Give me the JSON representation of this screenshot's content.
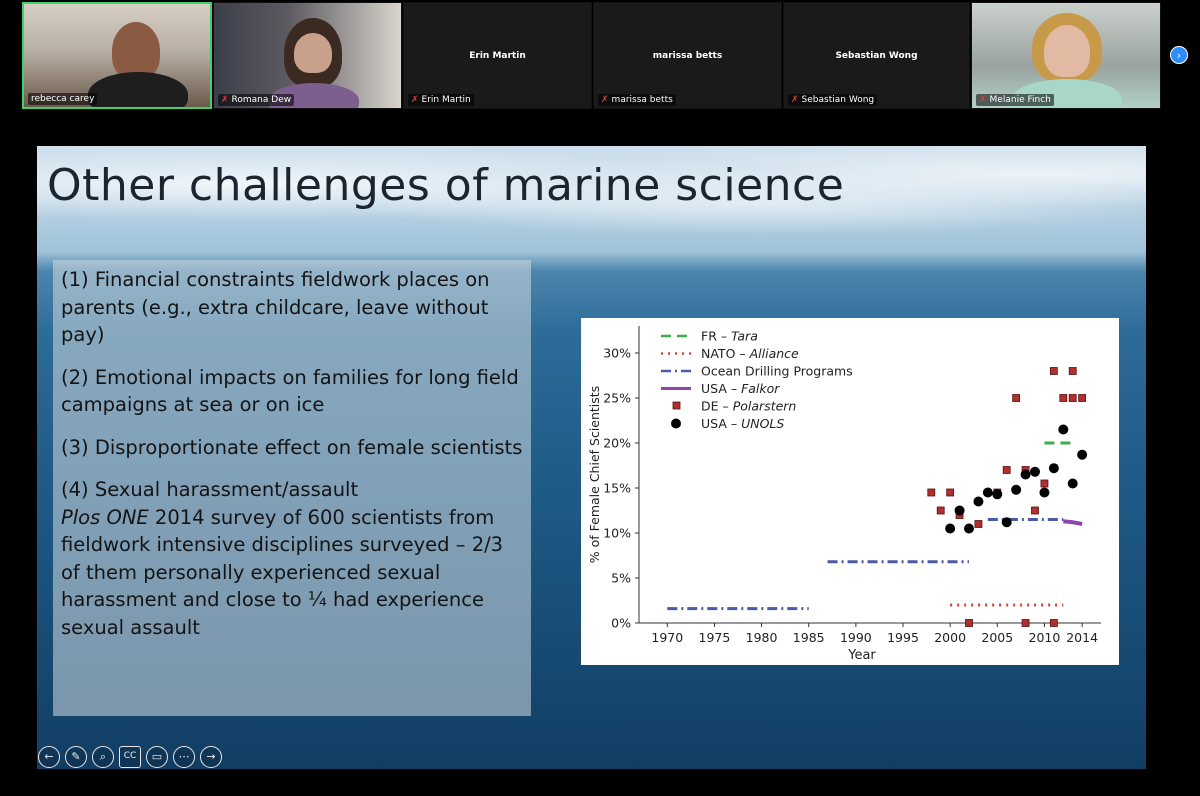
{
  "participants": [
    {
      "name": "rebecca carey",
      "muted": false,
      "video": true
    },
    {
      "name": "Romana Dew",
      "muted": true,
      "video": true
    },
    {
      "name": "Erin Martin",
      "muted": true,
      "video": false
    },
    {
      "name": "marissa betts",
      "muted": true,
      "video": false
    },
    {
      "name": "Sebastian Wong",
      "muted": true,
      "video": false
    },
    {
      "name": "Melanie Finch",
      "muted": true,
      "video": true
    }
  ],
  "next_icon": "chevron-right-icon",
  "slide": {
    "title": "Other challenges of marine science",
    "points": [
      {
        "num": "(1)",
        "text": " Financial constraints fieldwork places on parents (e.g., extra childcare, leave without pay)"
      },
      {
        "num": "(2)",
        "text": " Emotional impacts on families  for long field campaigns at sea or on ice"
      },
      {
        "num": "(3)",
        "text": " Disproportionate effect on female scientists"
      },
      {
        "num": "(4)",
        "text": " Sexual harassment/assault",
        "journal": "Plos ONE",
        "detail": "  2014 survey of 600 scientists from fieldwork intensive disciplines surveyed – 2/3 of them personally experienced sexual harassment and close to ¼ had experience sexual assault"
      }
    ]
  },
  "controls": [
    {
      "name": "previous-slide-icon",
      "glyph": "←"
    },
    {
      "name": "pen-icon",
      "glyph": "✎"
    },
    {
      "name": "zoom-icon",
      "glyph": "⌕"
    },
    {
      "name": "captions-icon",
      "glyph": "CC"
    },
    {
      "name": "video-icon",
      "glyph": "▭"
    },
    {
      "name": "more-options-icon",
      "glyph": "⋯"
    },
    {
      "name": "next-slide-icon",
      "glyph": "→"
    }
  ],
  "chart_data": {
    "type": "scatter",
    "xlabel": "Year",
    "ylabel": "% of Female Chief Scientists",
    "xlim": [
      1967,
      2016
    ],
    "ylim": [
      0,
      0.33
    ],
    "xticks": [
      1970,
      1975,
      1980,
      1985,
      1990,
      1995,
      2000,
      2005,
      2010,
      2014
    ],
    "yticks": [
      {
        "value": 0,
        "label": "0%"
      },
      {
        "value": 0.05,
        "label": "5%"
      },
      {
        "value": 0.1,
        "label": "10%"
      },
      {
        "value": 0.15,
        "label": "15%"
      },
      {
        "value": 0.2,
        "label": "20%"
      },
      {
        "value": 0.25,
        "label": "25%"
      },
      {
        "value": 0.3,
        "label": "30%"
      }
    ],
    "legend_position": "top-left",
    "series": [
      {
        "prefix": "FR – ",
        "name": "Tara",
        "kind": "dashed",
        "color": "#3dab4e",
        "x": [
          2010,
          2013
        ],
        "y": [
          0.2,
          0.2
        ]
      },
      {
        "prefix": "NATO – ",
        "name": "Alliance",
        "kind": "dotted",
        "color": "#d0493b",
        "x": [
          2000,
          2012
        ],
        "y": [
          0.02,
          0.02
        ]
      },
      {
        "prefix": "",
        "name": "Ocean Drilling Programs",
        "kind": "dashdot",
        "color": "#4a5aa8",
        "segments": [
          {
            "x": [
              1970,
              1985
            ],
            "y": [
              0.016,
              0.016
            ]
          },
          {
            "x": [
              1987,
              2002
            ],
            "y": [
              0.068,
              0.068
            ]
          },
          {
            "x": [
              2004,
              2012
            ],
            "y": [
              0.115,
              0.115
            ]
          }
        ]
      },
      {
        "prefix": "USA – ",
        "name": "Falkor",
        "kind": "solid",
        "color": "#8e44ad",
        "x": [
          2012,
          2013,
          2014
        ],
        "y": [
          0.113,
          0.112,
          0.11
        ]
      },
      {
        "prefix": "DE – ",
        "name": "Polarstern",
        "kind": "square",
        "color": "#b03030",
        "x": [
          1998,
          1999,
          2000,
          2001,
          2003,
          2005,
          2006,
          2007,
          2008,
          2009,
          2010,
          2011,
          2012,
          2013,
          2013,
          2014,
          2002,
          2008,
          2011
        ],
        "y": [
          0.145,
          0.125,
          0.145,
          0.12,
          0.11,
          0.145,
          0.17,
          0.25,
          0.17,
          0.125,
          0.155,
          0.28,
          0.25,
          0.28,
          0.25,
          0.25,
          0.0,
          0.0,
          0.0
        ]
      },
      {
        "prefix": "USA – ",
        "name": "UNOLS",
        "kind": "circle",
        "color": "#000000",
        "x": [
          2000,
          2001,
          2002,
          2003,
          2004,
          2005,
          2006,
          2007,
          2008,
          2009,
          2010,
          2011,
          2012,
          2013,
          2014
        ],
        "y": [
          0.105,
          0.125,
          0.105,
          0.135,
          0.145,
          0.143,
          0.112,
          0.148,
          0.165,
          0.168,
          0.145,
          0.172,
          0.215,
          0.155,
          0.187
        ]
      }
    ]
  }
}
